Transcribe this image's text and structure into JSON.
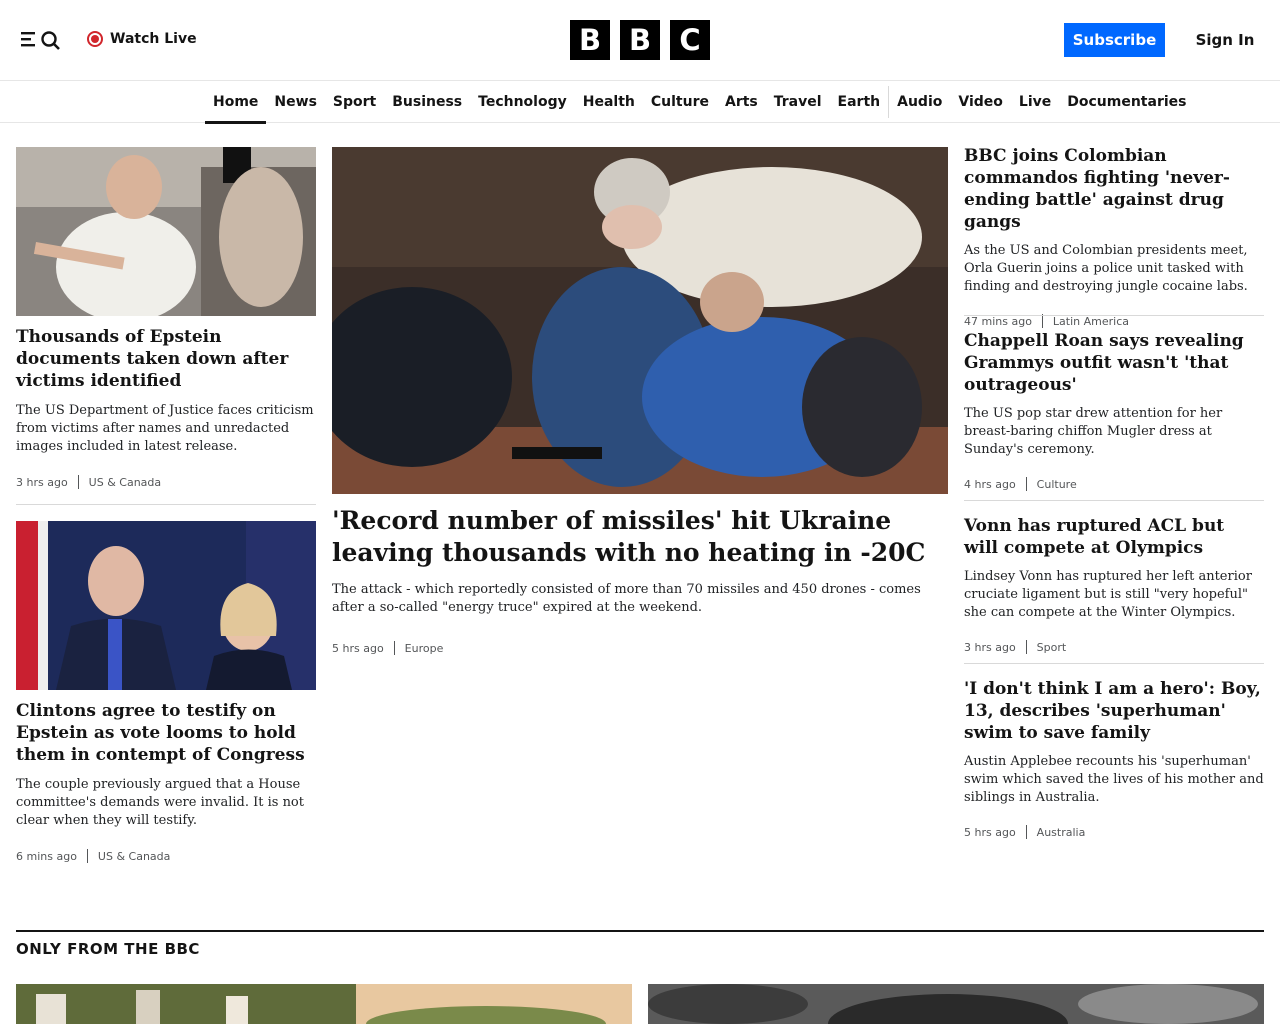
{
  "header": {
    "watch_live": "Watch Live",
    "logo_letters": [
      "B",
      "B",
      "C"
    ],
    "subscribe": "Subscribe",
    "sign_in": "Sign In",
    "icons": [
      "menu-icon",
      "search-icon",
      "live-icon"
    ]
  },
  "nav": {
    "items": [
      "Home",
      "News",
      "Sport",
      "Business",
      "Technology",
      "Health",
      "Culture",
      "Arts",
      "Travel",
      "Earth",
      "Audio",
      "Video",
      "Live",
      "Documentaries"
    ],
    "active": "Home"
  },
  "left": [
    {
      "headline": "Thousands of Epstein documents taken down after victims identified",
      "summary": "The US Department of Justice faces criticism from victims after names and unredacted images included in latest release.",
      "time": "3 hrs ago",
      "tag": "US & Canada"
    },
    {
      "headline": "Clintons agree to testify on Epstein as vote looms to hold them in contempt of Congress",
      "summary": "The couple previously argued that a House committee's demands were invalid. It is not clear when they will testify.",
      "time": "6 mins ago",
      "tag": "US & Canada"
    }
  ],
  "main": {
    "headline": "'Record number of missiles' hit Ukraine leaving thousands with no heating in -20C",
    "summary": "The attack - which reportedly consisted of more than 70 missiles and 450 drones - comes after a so-called \"energy truce\" expired at the weekend.",
    "time": "5 hrs ago",
    "tag": "Europe"
  },
  "right": [
    {
      "headline": "BBC joins Colombian commandos fighting 'never-ending battle' against drug gangs",
      "summary": "As the US and Colombian presidents meet, Orla Guerin joins a police unit tasked with finding and destroying jungle cocaine labs.",
      "time": "47 mins ago",
      "tag": "Latin America"
    },
    {
      "headline": "Chappell Roan says revealing Grammys outfit wasn't 'that outrageous'",
      "summary": "The US pop star drew attention for her breast-baring chiffon Mugler dress at Sunday's ceremony.",
      "time": "4 hrs ago",
      "tag": "Culture"
    },
    {
      "headline": "Vonn has ruptured ACL but will compete at Olympics",
      "summary": "Lindsey Vonn has ruptured her left anterior cruciate ligament but is still \"very hopeful\" she can compete at the Winter Olympics.",
      "time": "3 hrs ago",
      "tag": "Sport"
    },
    {
      "headline": "'I don't think I am a hero': Boy, 13, describes 'superhuman' swim to save family",
      "summary": "Austin Applebee recounts his 'superhuman' swim which saved the lives of his mother and siblings in Australia.",
      "time": "5 hrs ago",
      "tag": "Australia"
    }
  ],
  "section": {
    "title": "ONLY FROM THE BBC"
  },
  "colors": {
    "accent": "#0068ff",
    "live": "#d1262c",
    "text": "#141414"
  }
}
